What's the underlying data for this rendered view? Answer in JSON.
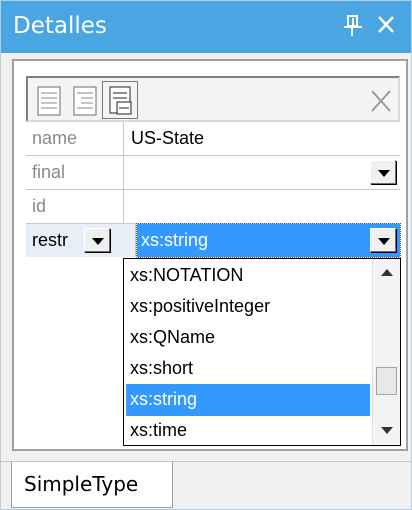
{
  "window": {
    "title": "Detalles"
  },
  "toolbar": {
    "icons": [
      "list-icon",
      "list-indent-icon",
      "list-tree-icon",
      "delete-icon"
    ]
  },
  "properties": [
    {
      "label": "name",
      "value": "US-State"
    },
    {
      "label": "final",
      "value": ""
    },
    {
      "label": "id",
      "value": ""
    },
    {
      "label": "restr",
      "value": "xs:string"
    }
  ],
  "dropdown": {
    "items": [
      "xs:NOTATION",
      "xs:positiveInteger",
      "xs:QName",
      "xs:short",
      "xs:string",
      "xs:time"
    ],
    "selected": "xs:string"
  },
  "tabs": [
    {
      "label": "SimpleType"
    }
  ]
}
